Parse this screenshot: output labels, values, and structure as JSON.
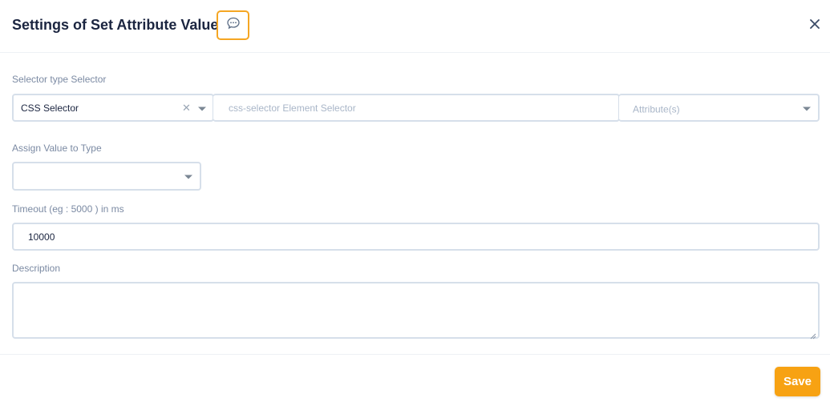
{
  "dialog": {
    "title": "Settings of Set Attribute Value"
  },
  "selector": {
    "label": "Selector type Selector",
    "type_value": "CSS Selector",
    "element_placeholder": "css-selector Element Selector",
    "element_value": "",
    "attribute_placeholder": "Attribute(s)"
  },
  "assign": {
    "label": "Assign Value to Type",
    "value": ""
  },
  "timeout": {
    "label": "Timeout (eg : 5000 ) in ms",
    "value": "10000"
  },
  "description": {
    "label": "Description",
    "value": ""
  },
  "footer": {
    "save_label": "Save"
  },
  "icons": {
    "comment": "comment-icon",
    "close": "close-icon",
    "clear": "clear-icon",
    "dropdown": "chevron-down-icon"
  },
  "colors": {
    "accent": "#f7a213",
    "border": "#d6dfea",
    "label": "#7b8aa3",
    "title": "#1b2540"
  }
}
